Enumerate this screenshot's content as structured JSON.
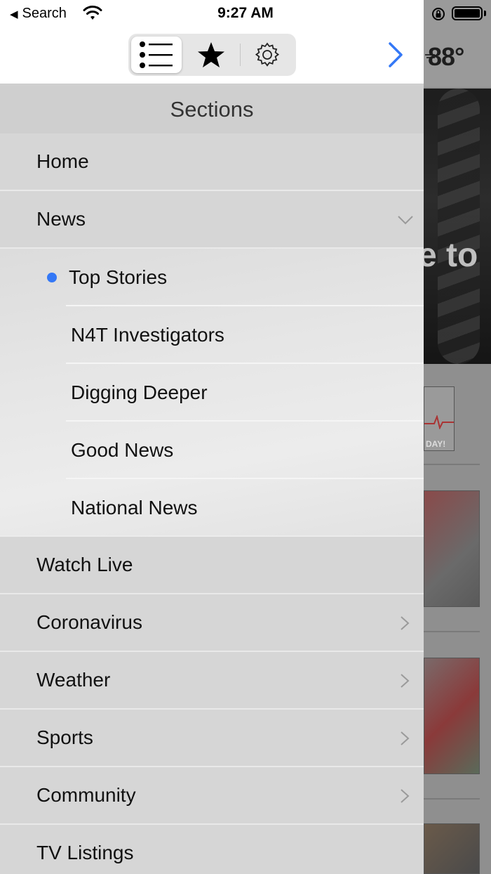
{
  "status_bar": {
    "back_label": "Search",
    "time": "9:27 AM"
  },
  "toolbar": {
    "segments": [
      {
        "name": "list",
        "icon": "list-icon",
        "selected": true
      },
      {
        "name": "favorites",
        "icon": "star-icon",
        "selected": false
      },
      {
        "name": "settings",
        "icon": "gear-icon",
        "selected": false
      }
    ],
    "next_icon": "chevron-right-icon",
    "accent_color": "#3478f6"
  },
  "background_page": {
    "temperature": "88°",
    "hero_partial_text": "e to",
    "thumb_label": "DAY!"
  },
  "drawer": {
    "header": "Sections",
    "items": [
      {
        "label": "Home"
      },
      {
        "label": "News",
        "expanded": true
      },
      {
        "label": "Watch Live"
      },
      {
        "label": "Coronavirus",
        "has_children": true
      },
      {
        "label": "Weather",
        "has_children": true
      },
      {
        "label": "Sports",
        "has_children": true
      },
      {
        "label": "Community",
        "has_children": true
      },
      {
        "label": "TV Listings"
      }
    ],
    "news_subitems": [
      {
        "label": "Top Stories",
        "selected": true
      },
      {
        "label": "N4T Investigators"
      },
      {
        "label": "Digging Deeper"
      },
      {
        "label": "Good News"
      },
      {
        "label": "National News"
      }
    ]
  }
}
